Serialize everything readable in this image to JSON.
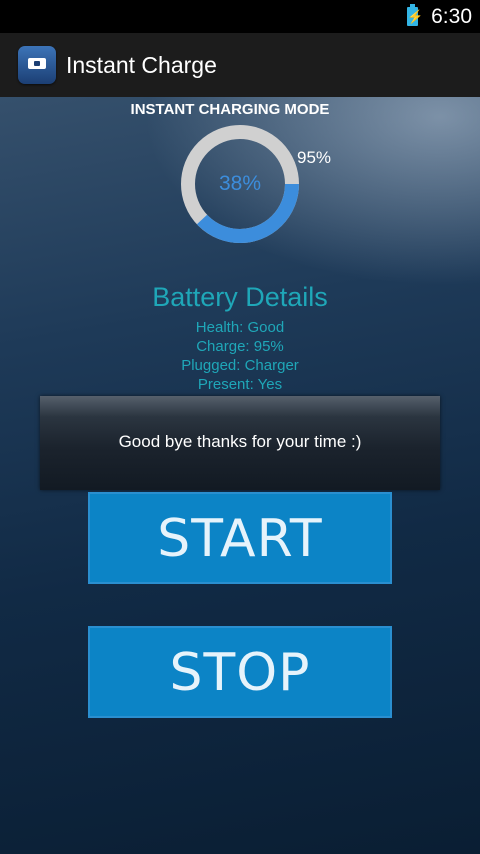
{
  "status_bar": {
    "time": "6:30",
    "battery_icon": "battery-charging-icon"
  },
  "action_bar": {
    "app_icon": "app-icon",
    "title": "Instant Charge"
  },
  "mode": {
    "label": "INSTANT CHARGING MODE"
  },
  "gauge": {
    "value_text": "38%",
    "value": 38,
    "level_text": "95%"
  },
  "details": {
    "title": "Battery Details",
    "lines": [
      "Health: Good",
      "Charge: 95%",
      "Plugged: Charger",
      "Present: Yes"
    ]
  },
  "toast": {
    "message": "Good bye thanks for your time :)"
  },
  "buttons": {
    "start": "START",
    "stop": "STOP"
  },
  "colors": {
    "accent": "#0c84c6",
    "gauge_fill": "#3c8ddc",
    "gauge_track": "#d0d0d0",
    "details_text": "#1fa7b8"
  }
}
